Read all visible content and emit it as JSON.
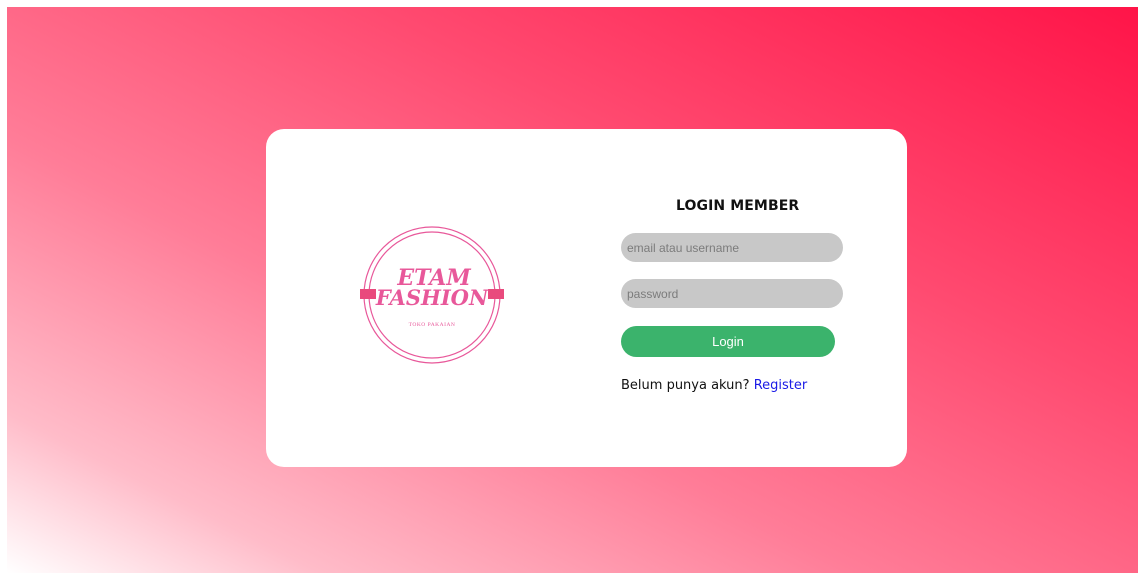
{
  "brand": {
    "name_line1": "ETAM",
    "name_line2": "FASHION",
    "tagline": "TOKO PAKAIAN",
    "color": "#e8589a",
    "accent": "#e94a7d"
  },
  "login": {
    "title": "LOGIN MEMBER",
    "email_placeholder": "email atau username",
    "password_placeholder": "password",
    "button_label": "Login",
    "prompt": "Belum punya akun? ",
    "register_label": "Register"
  },
  "colors": {
    "button": "#3bb36c",
    "link": "#1a1ae6",
    "field": "#c8c8c8",
    "gradient_start": "#ffffff",
    "gradient_end": "#ff1448"
  }
}
